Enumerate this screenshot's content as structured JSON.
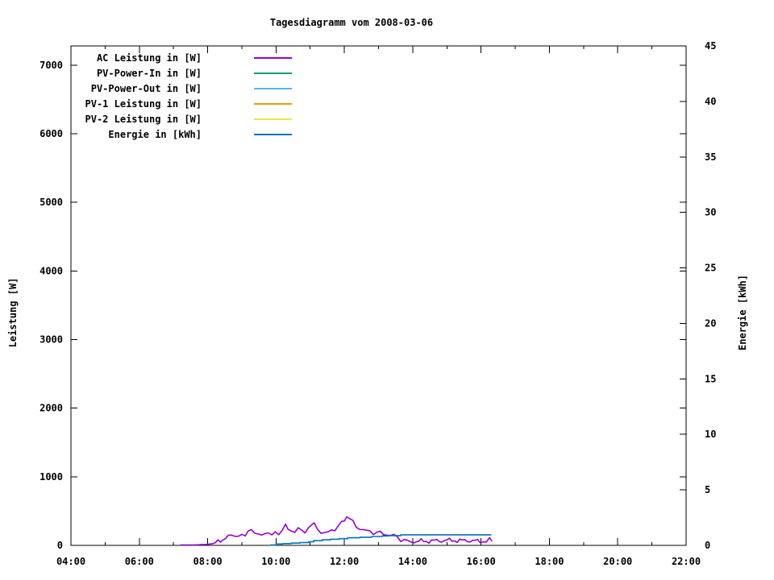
{
  "chart_data": {
    "type": "line",
    "title": "Tagesdiagramm vom 2008-03-06",
    "background": "#ffffff",
    "border_color": "#000000",
    "x_axis": {
      "label": "",
      "range_hours": [
        4,
        22
      ],
      "major_tick_hours": [
        4,
        6,
        8,
        10,
        12,
        14,
        16,
        18,
        20,
        22
      ],
      "tick_labels": [
        "04:00",
        "06:00",
        "08:00",
        "10:00",
        "12:00",
        "14:00",
        "16:00",
        "18:00",
        "20:00",
        "22:00"
      ],
      "minor_tick_hours": [
        5,
        7,
        9,
        11,
        13,
        15,
        17,
        19,
        21
      ]
    },
    "y_axis_left": {
      "label": "Leistung [W]",
      "range": [
        0,
        7280
      ],
      "ticks": [
        0,
        1000,
        2000,
        3000,
        4000,
        5000,
        6000,
        7000
      ]
    },
    "y_axis_right": {
      "label": "Energie [kWh]",
      "range": [
        0,
        45
      ],
      "ticks": [
        0,
        5,
        10,
        15,
        20,
        25,
        30,
        35,
        40,
        45
      ]
    },
    "legend": [
      {
        "label": "AC Leistung in [W]",
        "color": "#9400d3"
      },
      {
        "label": "PV-Power-In in [W]",
        "color": "#009e73"
      },
      {
        "label": "PV-Power-Out in [W]",
        "color": "#56b4e9"
      },
      {
        "label": "PV-1 Leistung in [W]",
        "color": "#e69f00"
      },
      {
        "label": "PV-2 Leistung in [W]",
        "color": "#f0e442"
      },
      {
        "label": "Energie in [kWh]",
        "color": "#0072b2"
      }
    ],
    "series": [
      {
        "name": "AC Leistung in [W]",
        "color": "#9400d3",
        "axis": "left",
        "style": "noisy-line",
        "points": [
          [
            7.2,
            3
          ],
          [
            7.4,
            5
          ],
          [
            7.6,
            6
          ],
          [
            7.8,
            10
          ],
          [
            8.0,
            15
          ],
          [
            8.15,
            25
          ],
          [
            8.3,
            55
          ],
          [
            8.45,
            90
          ],
          [
            8.6,
            125
          ],
          [
            8.7,
            150
          ],
          [
            8.8,
            135
          ],
          [
            8.9,
            155
          ],
          [
            9.0,
            140
          ],
          [
            9.1,
            120
          ],
          [
            9.18,
            225
          ],
          [
            9.28,
            235
          ],
          [
            9.38,
            175
          ],
          [
            9.48,
            140
          ],
          [
            9.58,
            165
          ],
          [
            9.68,
            195
          ],
          [
            9.78,
            155
          ],
          [
            9.88,
            150
          ],
          [
            9.98,
            205
          ],
          [
            10.08,
            170
          ],
          [
            10.18,
            215
          ],
          [
            10.28,
            280
          ],
          [
            10.35,
            250
          ],
          [
            10.45,
            215
          ],
          [
            10.55,
            195
          ],
          [
            10.65,
            235
          ],
          [
            10.75,
            220
          ],
          [
            10.85,
            215
          ],
          [
            10.95,
            240
          ],
          [
            11.05,
            290
          ],
          [
            11.12,
            310
          ],
          [
            11.22,
            255
          ],
          [
            11.32,
            185
          ],
          [
            11.42,
            155
          ],
          [
            11.52,
            205
          ],
          [
            11.62,
            235
          ],
          [
            11.72,
            220
          ],
          [
            11.82,
            270
          ],
          [
            11.92,
            330
          ],
          [
            12.0,
            385
          ],
          [
            12.07,
            425
          ],
          [
            12.15,
            395
          ],
          [
            12.25,
            330
          ],
          [
            12.35,
            280
          ],
          [
            12.45,
            245
          ],
          [
            12.55,
            225
          ],
          [
            12.65,
            210
          ],
          [
            12.75,
            200
          ],
          [
            12.85,
            190
          ],
          [
            12.95,
            185
          ],
          [
            13.05,
            180
          ],
          [
            13.15,
            170
          ],
          [
            13.25,
            155
          ],
          [
            13.35,
            150
          ],
          [
            13.45,
            140
          ],
          [
            13.55,
            120
          ],
          [
            13.65,
            90
          ],
          [
            13.75,
            70
          ],
          [
            13.85,
            60
          ],
          [
            13.95,
            55
          ],
          [
            14.1,
            58
          ],
          [
            14.25,
            62
          ],
          [
            14.4,
            60
          ],
          [
            14.55,
            65
          ],
          [
            14.7,
            68
          ],
          [
            14.85,
            70
          ],
          [
            15.0,
            72
          ],
          [
            15.15,
            75
          ],
          [
            15.3,
            70
          ],
          [
            15.45,
            68
          ],
          [
            15.6,
            72
          ],
          [
            15.75,
            65
          ],
          [
            15.9,
            62
          ],
          [
            16.05,
            58
          ],
          [
            16.15,
            55
          ],
          [
            16.25,
            90
          ],
          [
            16.32,
            58
          ]
        ]
      },
      {
        "name": "Energie in [kWh]",
        "color": "#0072b2",
        "axis": "right",
        "style": "steps",
        "points": [
          [
            9.83,
            0.03
          ],
          [
            10.0,
            0.12
          ],
          [
            10.2,
            0.16
          ],
          [
            10.45,
            0.2
          ],
          [
            10.7,
            0.25
          ],
          [
            10.95,
            0.32
          ],
          [
            11.1,
            0.42
          ],
          [
            11.35,
            0.5
          ],
          [
            11.6,
            0.55
          ],
          [
            11.85,
            0.6
          ],
          [
            12.1,
            0.68
          ],
          [
            12.45,
            0.73
          ],
          [
            12.8,
            0.8
          ],
          [
            13.1,
            0.85
          ],
          [
            13.3,
            0.88
          ],
          [
            13.65,
            0.95
          ],
          [
            16.3,
            0.95
          ]
        ]
      }
    ]
  }
}
